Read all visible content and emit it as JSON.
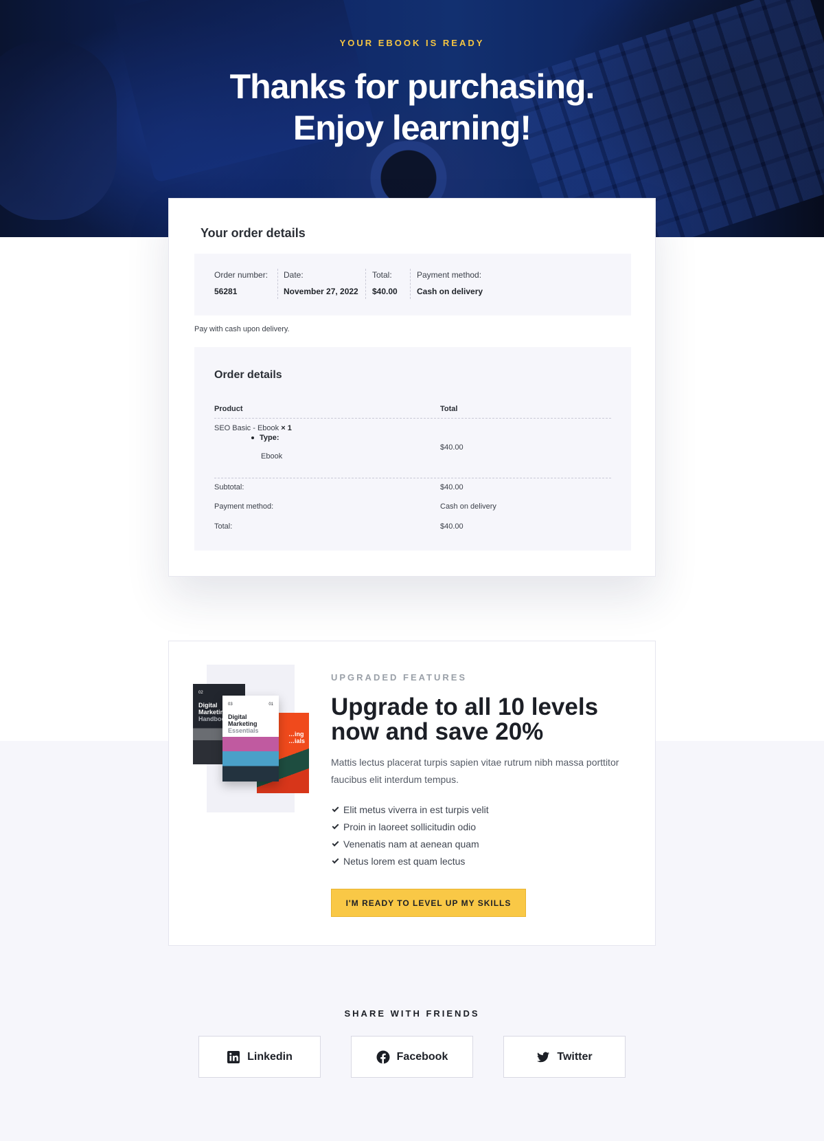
{
  "hero": {
    "eyebrow": "YOUR EBOOK IS READY",
    "title_line1": "Thanks for purchasing.",
    "title_line2": "Enjoy learning!"
  },
  "order": {
    "title": "Your order details",
    "summary": [
      {
        "label": "Order number:",
        "value": "56281"
      },
      {
        "label": "Date:",
        "value": "November 27, 2022"
      },
      {
        "label": "Total:",
        "value": "$40.00"
      },
      {
        "label": "Payment method:",
        "value": "Cash on delivery"
      }
    ],
    "pay_note": "Pay with cash upon delivery.",
    "details": {
      "title": "Order details",
      "headers": {
        "product": "Product",
        "total": "Total"
      },
      "item": {
        "name": "SEO Basic - Ebook",
        "qty": "× 1",
        "meta_label": "Type:",
        "meta_value": "Ebook",
        "total": "$40.00"
      },
      "totals": [
        {
          "label": "Subtotal:",
          "value": "$40.00"
        },
        {
          "label": "Payment method:",
          "value": "Cash on delivery"
        },
        {
          "label": "Total:",
          "value": "$40.00"
        }
      ]
    }
  },
  "upgrade": {
    "eyebrow": "UPGRADED FEATURES",
    "title": "Upgrade to all 10 levels now and save 20%",
    "description": "Mattis lectus placerat turpis sapien vitae rutrum nibh massa porttitor faucibus elit interdum tempus.",
    "features": [
      "Elit metus viverra in est turpis velit",
      "Proin in laoreet sollicitudin odio",
      "Venenatis nam at aenean quam",
      "Netus lorem est quam lectus"
    ],
    "cta": "I'M READY TO LEVEL UP MY SKILLS",
    "books": {
      "dark": {
        "num": "02",
        "title": "Digital Marketing",
        "sub": "Handbook"
      },
      "white": {
        "num": "03",
        "num2": "01",
        "title": "Digital Marketing",
        "sub": "Essentials"
      },
      "orange": {
        "num": "02",
        "title": "…ing …ials"
      }
    }
  },
  "share": {
    "title": "SHARE WITH FRIENDS",
    "buttons": [
      {
        "label": "Linkedin",
        "icon": "linkedin-icon"
      },
      {
        "label": "Facebook",
        "icon": "facebook-icon"
      },
      {
        "label": "Twitter",
        "icon": "twitter-icon"
      }
    ]
  },
  "colors": {
    "accent": "#f9c846",
    "eyebrow_hero": "#f5c542",
    "hero_blue": "#123070",
    "panel_bg": "#f6f6fb"
  }
}
